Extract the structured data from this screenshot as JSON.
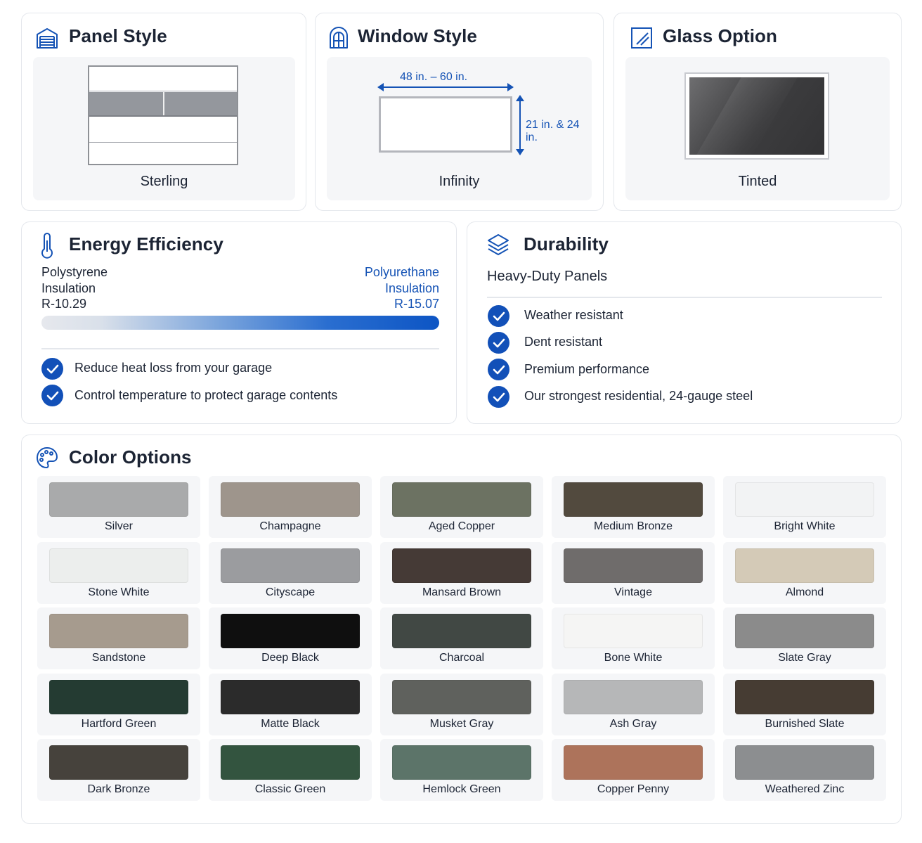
{
  "panel_style": {
    "title": "Panel Style",
    "icon": "garage-door-icon",
    "option": "Sterling"
  },
  "window_style": {
    "title": "Window Style",
    "icon": "arched-window-icon",
    "option": "Infinity",
    "width_label": "48 in. – 60 in.",
    "height_label": "21 in. & 24 in."
  },
  "glass_option": {
    "title": "Glass Option",
    "icon": "glass-pane-icon",
    "option": "Tinted"
  },
  "energy": {
    "title": "Energy Efficiency",
    "icon": "thermometer-icon",
    "left_lines": [
      "Polystyrene",
      "Insulation",
      "R-10.29"
    ],
    "right_lines": [
      "Polyurethane",
      "Insulation",
      "R-15.07"
    ],
    "features": [
      "Reduce heat loss from your garage",
      "Control temperature to protect garage contents"
    ]
  },
  "durability": {
    "title": "Durability",
    "icon": "layers-icon",
    "subtitle": "Heavy-Duty Panels",
    "features": [
      "Weather resistant",
      "Dent resistant",
      "Premium performance",
      "Our strongest residential, 24-gauge steel"
    ]
  },
  "colors": {
    "title": "Color Options",
    "icon": "palette-icon",
    "items": [
      {
        "name": "Silver",
        "color": "#a9aaab"
      },
      {
        "name": "Champagne",
        "color": "#9e958c"
      },
      {
        "name": "Aged Copper",
        "color": "#6c7262"
      },
      {
        "name": "Medium Bronze",
        "color": "#524a3e"
      },
      {
        "name": "Bright White",
        "color": "#f2f3f4"
      },
      {
        "name": "Stone White",
        "color": "#eceeed"
      },
      {
        "name": "Cityscape",
        "color": "#9b9c9f"
      },
      {
        "name": "Mansard Brown",
        "color": "#453a36"
      },
      {
        "name": "Vintage",
        "color": "#6f6c6b"
      },
      {
        "name": "Almond",
        "color": "#d4cab7"
      },
      {
        "name": "Sandstone",
        "color": "#a69b8e"
      },
      {
        "name": "Deep Black",
        "color": "#0f0f0f"
      },
      {
        "name": "Charcoal",
        "color": "#414844"
      },
      {
        "name": "Bone White",
        "color": "#f5f5f4"
      },
      {
        "name": "Slate Gray",
        "color": "#8b8b8b"
      },
      {
        "name": "Hartford Green",
        "color": "#243b32"
      },
      {
        "name": "Matte Black",
        "color": "#2b2b2b"
      },
      {
        "name": "Musket Gray",
        "color": "#5f615d"
      },
      {
        "name": "Ash Gray",
        "color": "#b6b7b8"
      },
      {
        "name": "Burnished Slate",
        "color": "#463c33"
      },
      {
        "name": "Dark Bronze",
        "color": "#46423c"
      },
      {
        "name": "Classic Green",
        "color": "#33543f"
      },
      {
        "name": "Hemlock Green",
        "color": "#5c7469"
      },
      {
        "name": "Copper Penny",
        "color": "#ad735b"
      },
      {
        "name": "Weathered Zinc",
        "color": "#8c8e90"
      }
    ]
  },
  "accent_color": "#1250b8"
}
